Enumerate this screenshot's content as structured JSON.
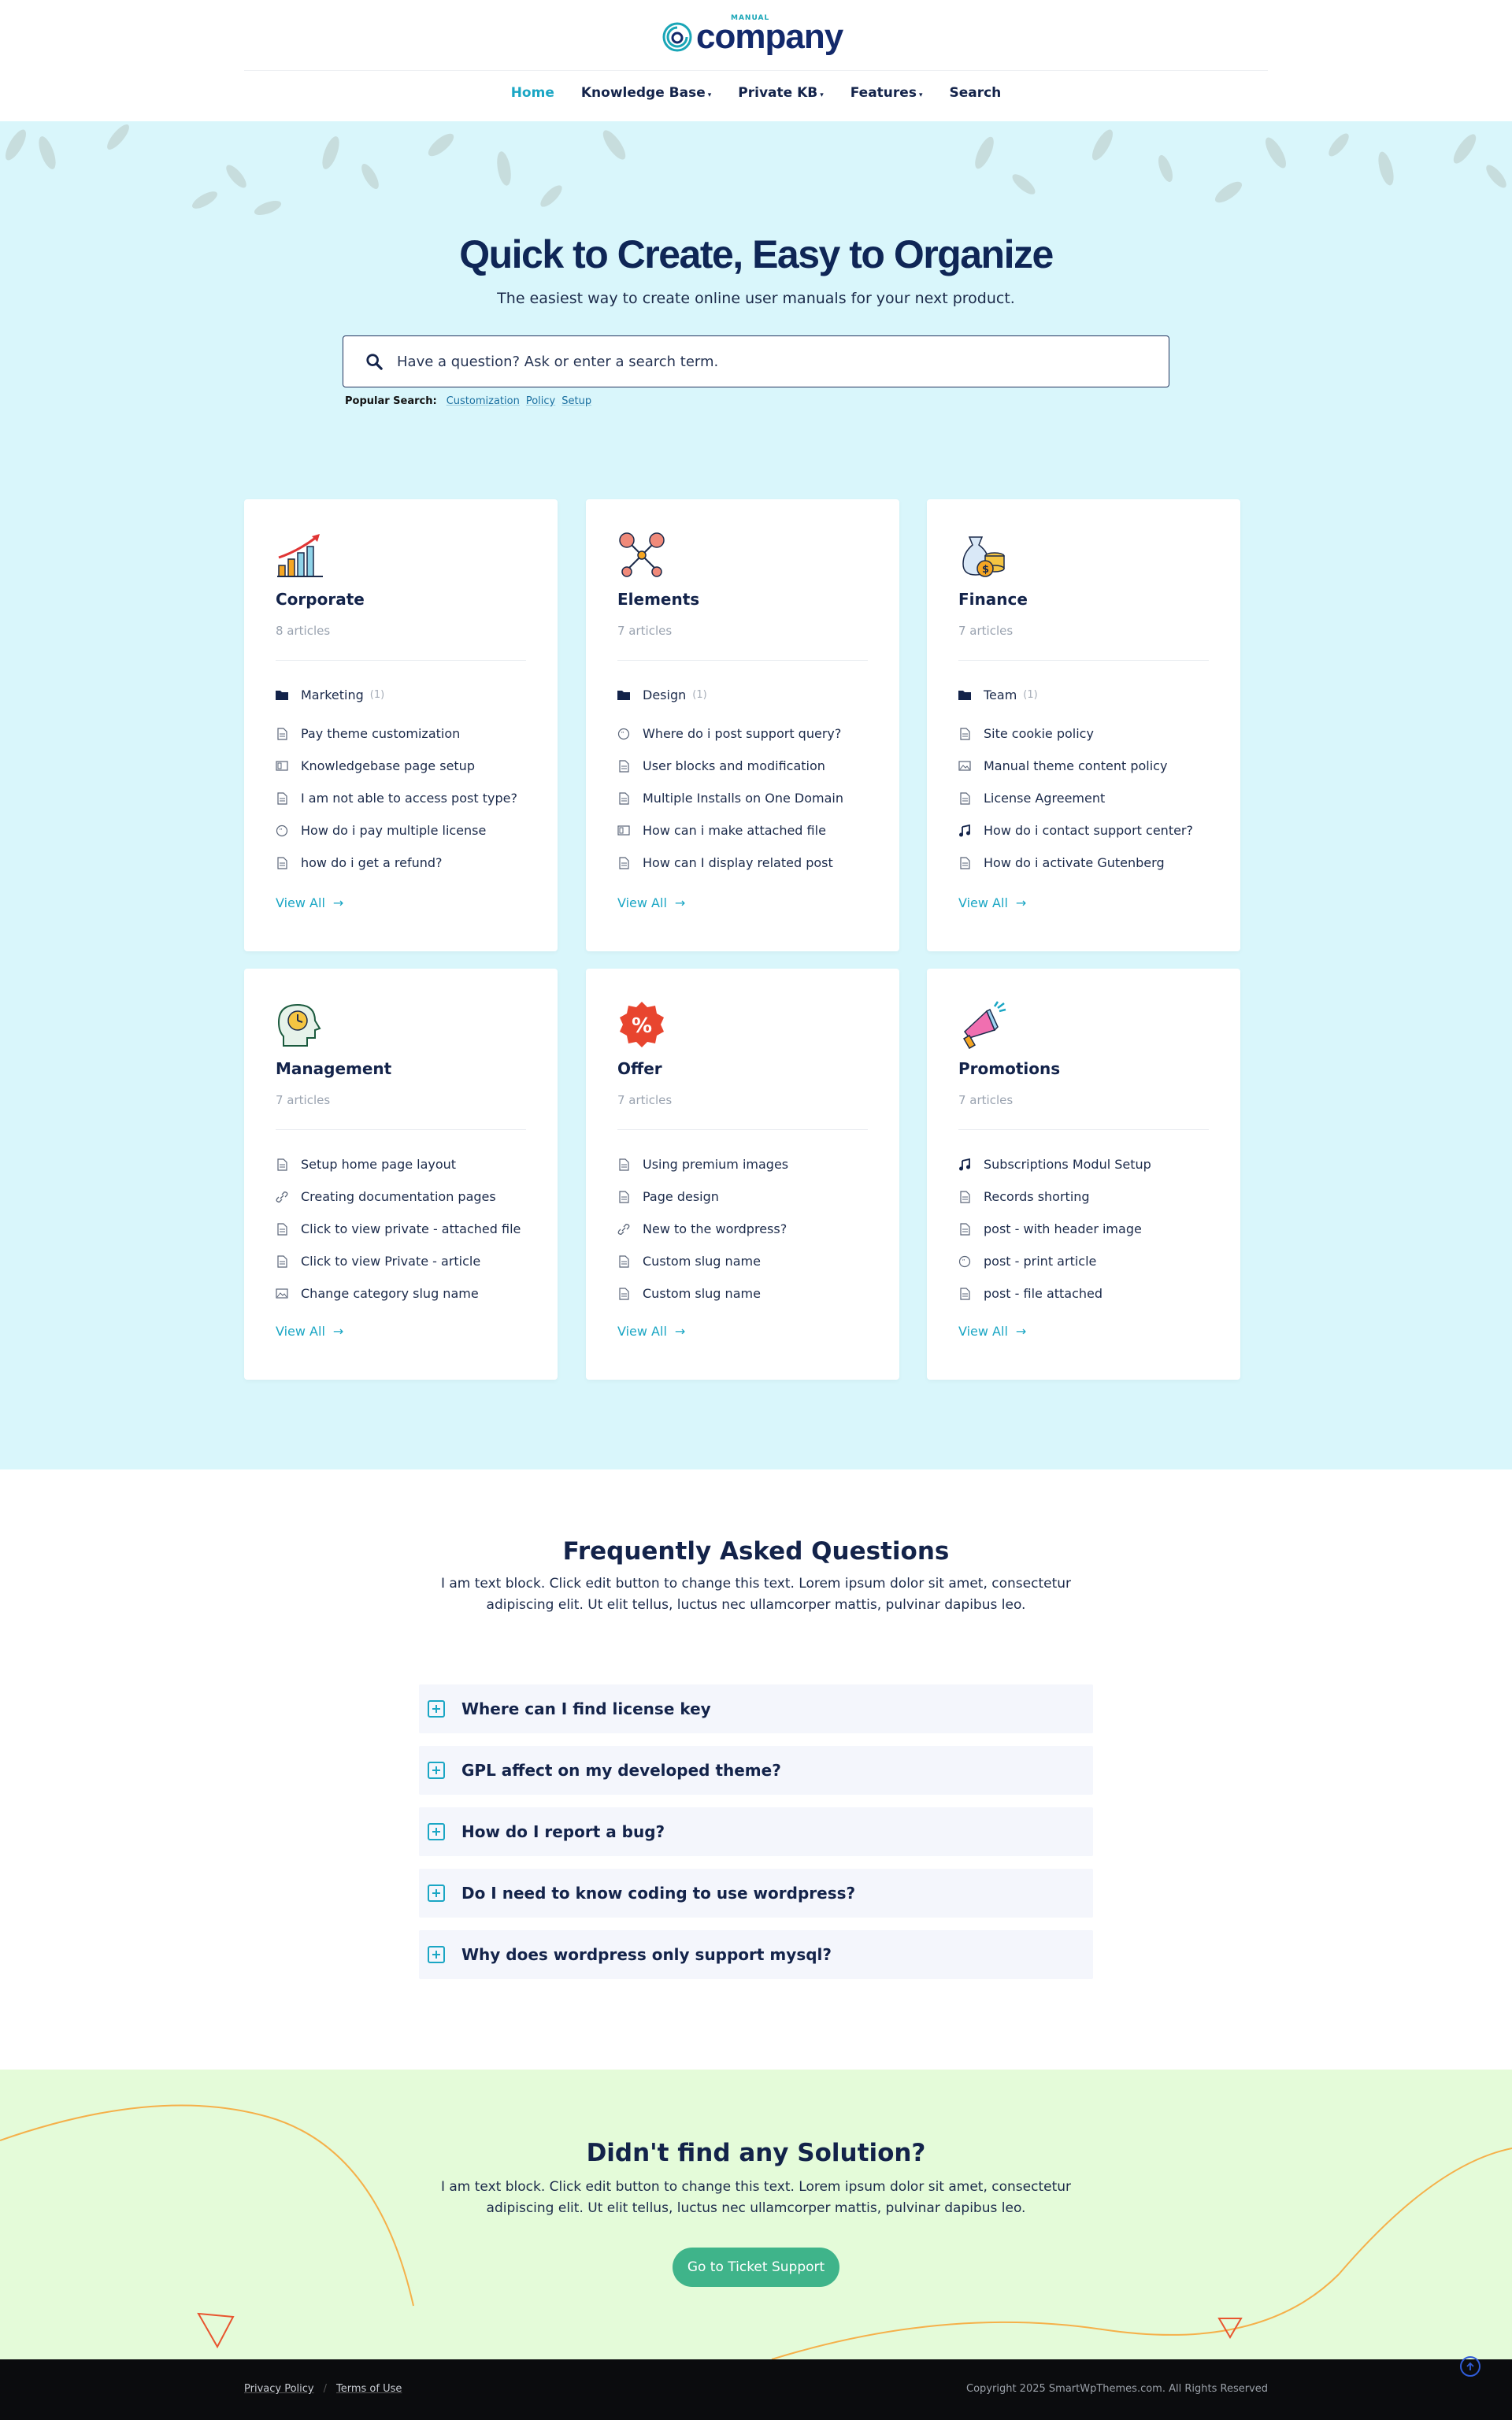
{
  "logo": {
    "small": "MANUAL",
    "main": "company"
  },
  "nav": {
    "items": [
      {
        "label": "Home",
        "active": true
      },
      {
        "label": "Knowledge Base",
        "dropdown": true
      },
      {
        "label": "Private KB",
        "dropdown": true
      },
      {
        "label": "Features",
        "dropdown": true
      },
      {
        "label": "Search"
      }
    ]
  },
  "hero": {
    "title": "Quick to Create, Easy to Organize",
    "subtitle": "The easiest way to create online user manuals for your next product.",
    "search_placeholder": "Have a question? Ask or enter a search term.",
    "popular_label": "Popular Search:",
    "popular": [
      "Customization",
      "Policy",
      "Setup"
    ]
  },
  "cards": [
    {
      "title": "Corporate",
      "count": "8 articles",
      "icon": "chart-growth-icon",
      "folder": {
        "label": "Marketing",
        "count": "(1)"
      },
      "items": [
        {
          "icon": "document-icon",
          "label": "Pay theme customization"
        },
        {
          "icon": "video-icon",
          "label": "Knowledgebase page setup"
        },
        {
          "icon": "document-icon",
          "label": "I am not able to access post type?"
        },
        {
          "icon": "quote-icon",
          "label": "How do i pay multiple license"
        },
        {
          "icon": "document-icon",
          "label": "how do i get a refund?"
        }
      ],
      "view_all": "View All"
    },
    {
      "title": "Elements",
      "count": "7 articles",
      "icon": "network-nodes-icon",
      "folder": {
        "label": "Design",
        "count": "(1)"
      },
      "items": [
        {
          "icon": "quote-icon",
          "label": "Where do i post support query?"
        },
        {
          "icon": "document-icon",
          "label": "User blocks and modification"
        },
        {
          "icon": "document-icon",
          "label": "Multiple Installs on One Domain"
        },
        {
          "icon": "video-icon",
          "label": "How can i make attached file"
        },
        {
          "icon": "document-icon",
          "label": "How can I display related post"
        }
      ],
      "view_all": "View All"
    },
    {
      "title": "Finance",
      "count": "7 articles",
      "icon": "money-bag-icon",
      "folder": {
        "label": "Team",
        "count": "(1)"
      },
      "items": [
        {
          "icon": "document-icon",
          "label": "Site cookie policy"
        },
        {
          "icon": "image-icon",
          "label": "Manual theme content policy"
        },
        {
          "icon": "document-icon",
          "label": "License Agreement"
        },
        {
          "icon": "music-icon",
          "label": "How do i contact support center?"
        },
        {
          "icon": "document-icon",
          "label": "How do i activate Gutenberg"
        }
      ],
      "view_all": "View All"
    },
    {
      "title": "Management",
      "count": "7 articles",
      "icon": "head-clock-icon",
      "items": [
        {
          "icon": "document-icon",
          "label": "Setup home page layout"
        },
        {
          "icon": "link-icon",
          "label": "Creating documentation pages"
        },
        {
          "icon": "document-icon",
          "label": "Click to view private - attached file"
        },
        {
          "icon": "document-icon",
          "label": "Click to view Private - article"
        },
        {
          "icon": "image-icon",
          "label": "Change category slug name"
        }
      ],
      "view_all": "View All"
    },
    {
      "title": "Offer",
      "count": "7 articles",
      "icon": "percent-badge-icon",
      "items": [
        {
          "icon": "document-icon",
          "label": "Using premium images"
        },
        {
          "icon": "document-icon",
          "label": "Page design"
        },
        {
          "icon": "link-icon",
          "label": "New to the wordpress?"
        },
        {
          "icon": "document-icon",
          "label": "Custom slug name"
        },
        {
          "icon": "document-icon",
          "label": "Custom slug name"
        }
      ],
      "view_all": "View All"
    },
    {
      "title": "Promotions",
      "count": "7 articles",
      "icon": "megaphone-icon",
      "items": [
        {
          "icon": "music-icon",
          "label": "Subscriptions Modul Setup"
        },
        {
          "icon": "document-icon",
          "label": "Records shorting"
        },
        {
          "icon": "document-icon",
          "label": "post - with header image"
        },
        {
          "icon": "quote-icon",
          "label": "post - print article"
        },
        {
          "icon": "document-icon",
          "label": "post - file attached"
        }
      ],
      "view_all": "View All"
    }
  ],
  "faq": {
    "title": "Frequently Asked Questions",
    "text": "I am text block. Click edit button to change this text. Lorem ipsum dolor sit amet, consectetur adipiscing elit. Ut elit tellus, luctus nec ullamcorper mattis, pulvinar dapibus leo.",
    "items": [
      "Where can I find license key",
      "GPL affect on my developed theme?",
      "How do I report a bug?",
      "Do I need to know coding to use wordpress?",
      "Why does wordpress only support mysql?"
    ]
  },
  "solution": {
    "title": "Didn't find any Solution?",
    "text": "I am text block. Click edit button to change this text. Lorem ipsum dolor sit amet, consectetur adipiscing elit. Ut elit tellus, luctus nec ullamcorper mattis, pulvinar dapibus leo.",
    "button": "Go to Ticket Support"
  },
  "footer": {
    "links": [
      "Privacy Policy",
      "Terms of Use"
    ],
    "copyright": "Copyright 2025 SmartWpThemes.com. All Rights Reserved"
  },
  "colors": {
    "accent": "#1aa6c4",
    "navy": "#13234a",
    "hero_bg": "#d9f6fb",
    "solution_bg": "#e4fbd9",
    "button": "#3fb48a"
  }
}
